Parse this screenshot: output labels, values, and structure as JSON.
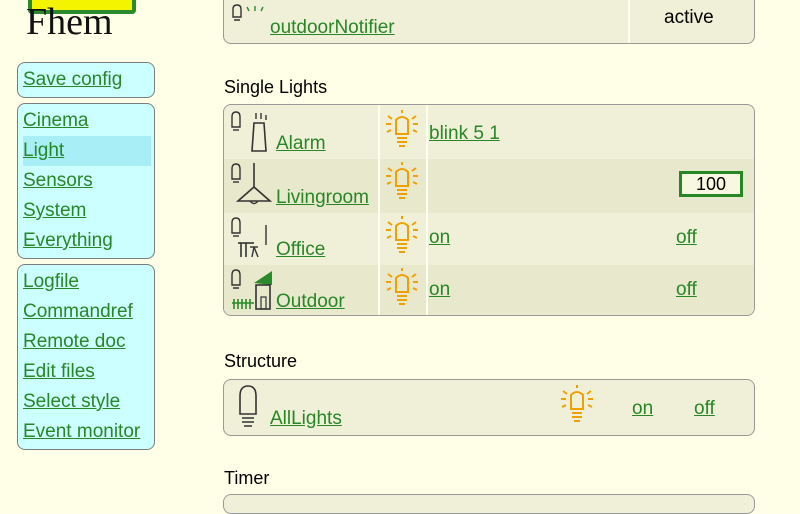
{
  "logo": {
    "text": "Fhem"
  },
  "menu": {
    "save": "Save config",
    "rooms": [
      "Cinema",
      "Light",
      "Sensors",
      "System",
      "Everything"
    ],
    "selected_room": "Light",
    "tools": [
      "Logfile",
      "Commandref",
      "Remote doc",
      "Edit files",
      "Select style",
      "Event monitor"
    ]
  },
  "top_section": {
    "device": "outdoorNotifier",
    "state": "active"
  },
  "single_lights": {
    "title": "Single Lights",
    "rows": [
      {
        "name": "Alarm",
        "cmd1": "blink 5 1"
      },
      {
        "name": "Livingroom",
        "value": "100"
      },
      {
        "name": "Office",
        "cmd1": "on",
        "cmd2": "off"
      },
      {
        "name": "Outdoor",
        "cmd1": "on",
        "cmd2": "off"
      }
    ]
  },
  "structure": {
    "title": "Structure",
    "device": "AllLights",
    "cmd1": "on",
    "cmd2": "off"
  },
  "timer": {
    "title": "Timer"
  },
  "colors": {
    "background": "#FFFFE7",
    "link": "#278727",
    "menu_bg": "#CCFFFF",
    "menu_selected": "#A8EEF6",
    "bulb": "#F0A000"
  }
}
